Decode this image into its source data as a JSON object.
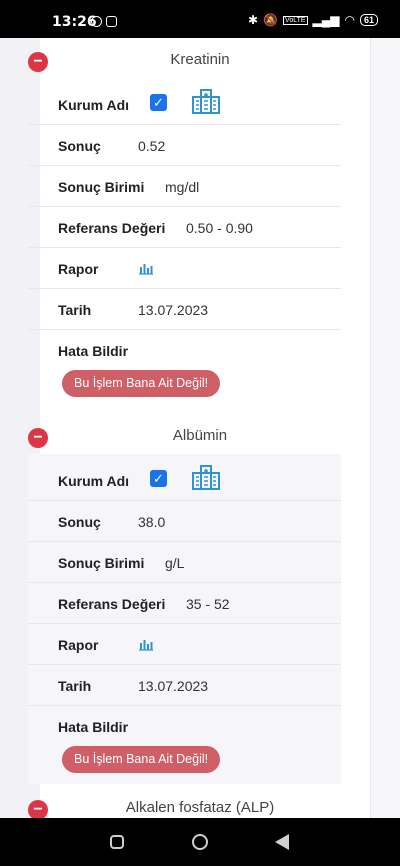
{
  "status_bar": {
    "time": "13:26",
    "battery": "61",
    "network": "VoLTE"
  },
  "groups": [
    {
      "title": "Kreatinin",
      "kurum_label": "Kurum Adı",
      "sonuc_label": "Sonuç",
      "sonuc_value": "0.52",
      "birim_label": "Sonuç Birimi",
      "birim_value": "mg/dl",
      "ref_label": "Referans Değeri",
      "ref_value": "0.50 - 0.90",
      "rapor_label": "Rapor",
      "tarih_label": "Tarih",
      "tarih_value": "13.07.2023",
      "hata_label": "Hata Bildir",
      "button_label": "Bu İşlem Bana Ait Değil!"
    },
    {
      "title": "Albümin",
      "kurum_label": "Kurum Adı",
      "sonuc_label": "Sonuç",
      "sonuc_value": "38.0",
      "birim_label": "Sonuç Birimi",
      "birim_value": "g/L",
      "ref_label": "Referans Değeri",
      "ref_value": "35 - 52",
      "rapor_label": "Rapor",
      "tarih_label": "Tarih",
      "tarih_value": "13.07.2023",
      "hata_label": "Hata Bildir",
      "button_label": "Bu İşlem Bana Ait Değil!"
    },
    {
      "title": "Alkalen fosfataz (ALP)"
    }
  ],
  "colors": {
    "accent_red": "#dc3545",
    "button_red": "#cf5f66",
    "icon_blue": "#2e93d1",
    "checkbox_blue": "#1a73e8"
  }
}
